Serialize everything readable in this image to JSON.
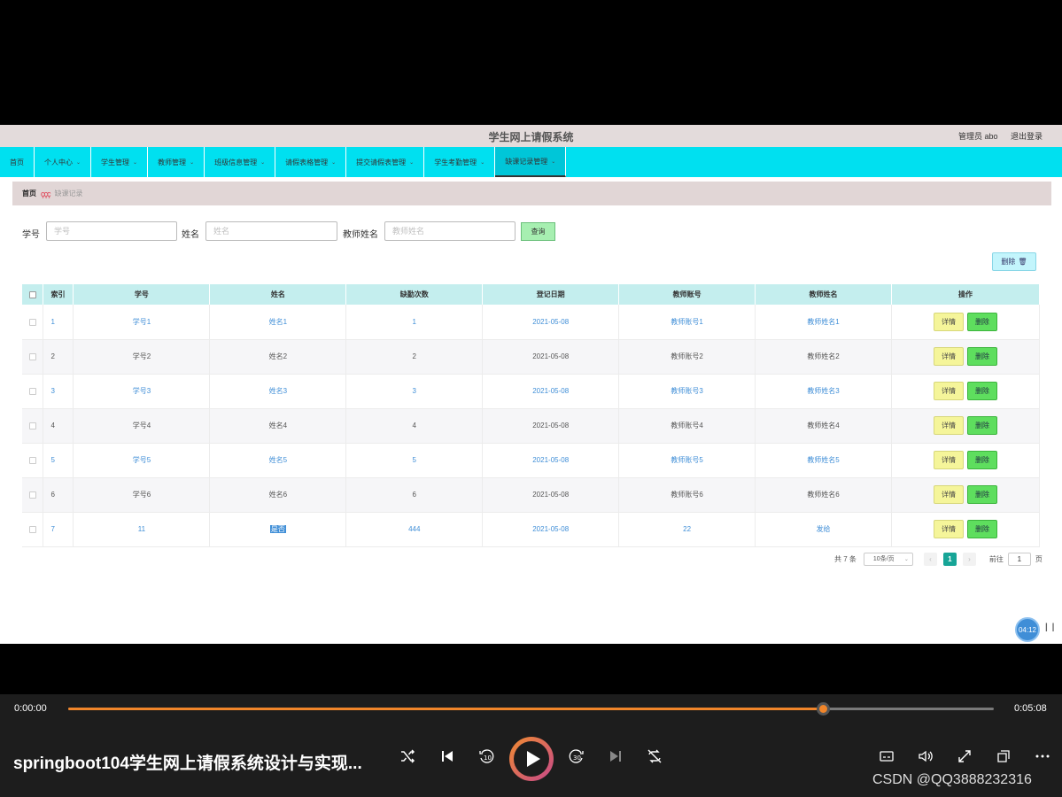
{
  "app": {
    "title": "学生网上请假系统",
    "user_label": "管理员 abo",
    "logout_label": "退出登录"
  },
  "nav": {
    "items": [
      {
        "label": "首页",
        "has_dropdown": false
      },
      {
        "label": "个人中心",
        "has_dropdown": true
      },
      {
        "label": "学生管理",
        "has_dropdown": true
      },
      {
        "label": "教师管理",
        "has_dropdown": true
      },
      {
        "label": "班级信息管理",
        "has_dropdown": true
      },
      {
        "label": "请假表格管理",
        "has_dropdown": true
      },
      {
        "label": "提交请假表管理",
        "has_dropdown": true
      },
      {
        "label": "学生考勤管理",
        "has_dropdown": true
      },
      {
        "label": "缺课记录管理",
        "has_dropdown": true,
        "active": true
      }
    ],
    "chevron": "⌄"
  },
  "breadcrumb": {
    "home": "首页",
    "separator": "ççç",
    "current": "缺课记录"
  },
  "search": {
    "student_no_label": "学号",
    "student_no_placeholder": "学号",
    "name_label": "姓名",
    "name_placeholder": "姓名",
    "teacher_name_label": "教师姓名",
    "teacher_name_placeholder": "教师姓名",
    "query_label": "查询"
  },
  "toolbar": {
    "delete_label": "删除",
    "delete_icon": "trash-icon"
  },
  "table": {
    "headers": {
      "index": "索引",
      "student_no": "学号",
      "name": "姓名",
      "absence_count": "缺勤次数",
      "register_date": "登记日期",
      "teacher_account": "教师账号",
      "teacher_name": "教师姓名",
      "actions": "操作"
    },
    "detail_label": "详情",
    "delete_label": "删除",
    "rows": [
      {
        "index": "1",
        "student_no": "学号1",
        "name": "姓名1",
        "absence_count": "1",
        "register_date": "2021-05-08",
        "teacher_account": "教师账号1",
        "teacher_name": "教师姓名1"
      },
      {
        "index": "2",
        "student_no": "学号2",
        "name": "姓名2",
        "absence_count": "2",
        "register_date": "2021-05-08",
        "teacher_account": "教师账号2",
        "teacher_name": "教师姓名2"
      },
      {
        "index": "3",
        "student_no": "学号3",
        "name": "姓名3",
        "absence_count": "3",
        "register_date": "2021-05-08",
        "teacher_account": "教师账号3",
        "teacher_name": "教师姓名3"
      },
      {
        "index": "4",
        "student_no": "学号4",
        "name": "姓名4",
        "absence_count": "4",
        "register_date": "2021-05-08",
        "teacher_account": "教师账号4",
        "teacher_name": "教师姓名4"
      },
      {
        "index": "5",
        "student_no": "学号5",
        "name": "姓名5",
        "absence_count": "5",
        "register_date": "2021-05-08",
        "teacher_account": "教师账号5",
        "teacher_name": "教师姓名5"
      },
      {
        "index": "6",
        "student_no": "学号6",
        "name": "姓名6",
        "absence_count": "6",
        "register_date": "2021-05-08",
        "teacher_account": "教师账号6",
        "teacher_name": "教师姓名6"
      },
      {
        "index": "7",
        "student_no": "11",
        "name": "是否",
        "absence_count": "444",
        "register_date": "2021-05-08",
        "teacher_account": "22",
        "teacher_name": "发给"
      }
    ]
  },
  "pagination": {
    "total_text": "共 7 条",
    "page_size": "10条/页",
    "prev": "‹",
    "next": "›",
    "current_page": "1",
    "goto_label": "前往",
    "goto_value": "1",
    "page_suffix": "页"
  },
  "overlay": {
    "timer": "04:12",
    "pause_glyph": "| |"
  },
  "player": {
    "current_time": "0:00:00",
    "total_time": "0:05:08",
    "progress": 0.815,
    "video_title": "springboot104学生网上请假系统设计与实现...",
    "accent_color": "#f0852a",
    "controls": [
      "shuffle-icon",
      "previous-icon",
      "rewind-10-icon",
      "play-icon",
      "forward-30-icon",
      "next-icon",
      "repeat-off-icon",
      "subtitles-icon",
      "volume-icon",
      "fullscreen-icon",
      "mini-player-icon",
      "more-icon"
    ]
  },
  "watermark": "CSDN @QQ3888232316"
}
